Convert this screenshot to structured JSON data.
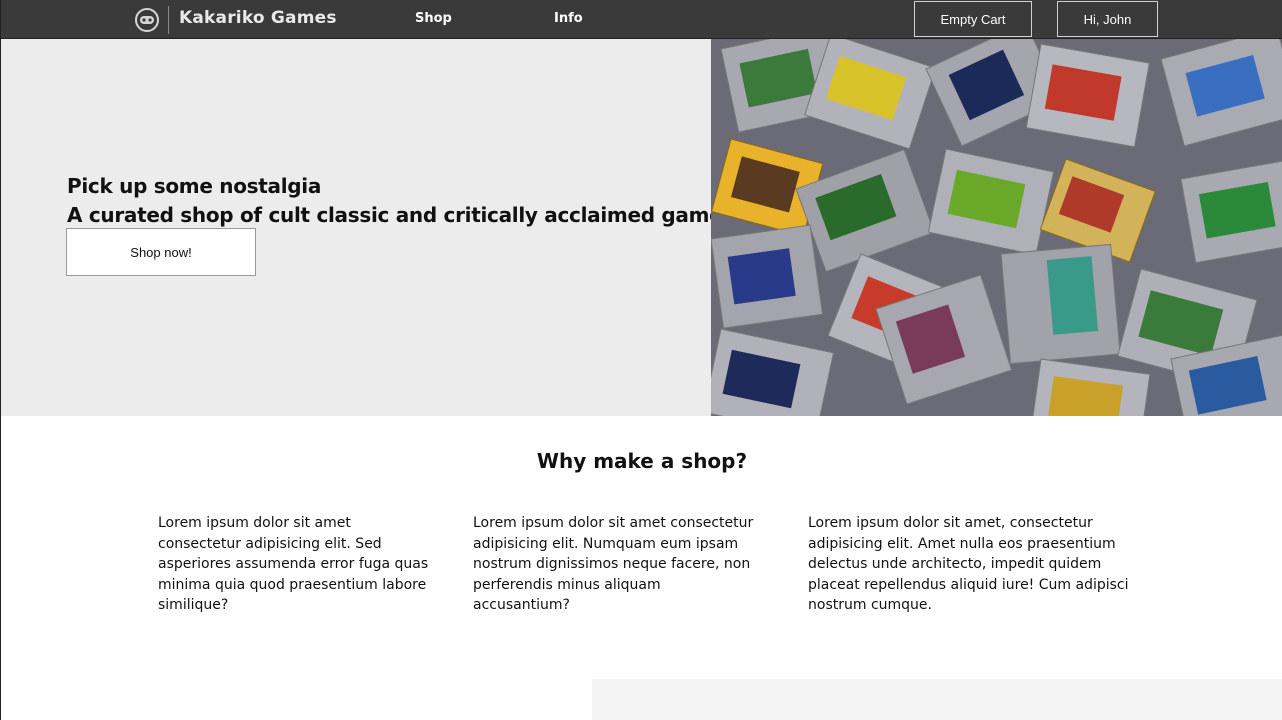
{
  "navbar": {
    "logo_icon": "gamepad-icon",
    "brand": "Kakariko Games",
    "links": [
      {
        "label": "Shop"
      },
      {
        "label": "Info"
      }
    ],
    "cart_button": "Empty Cart",
    "user_button": "Hi, John",
    "background": "#3a3a3a"
  },
  "hero": {
    "line1": "Pick up some nostalgia",
    "line2": "A curated shop of cult classic and critically acclaimed games",
    "cta_label": "Shop now!",
    "image_icon": "game-cartridges-photo",
    "background": "#ececec"
  },
  "why": {
    "title": "Why make a shop?",
    "columns": [
      {
        "text": "Lorem ipsum dolor sit amet consectetur adipisicing elit. Sed asperiores assumenda error fuga quas minima quia quod praesentium labore similique?"
      },
      {
        "text": "Lorem ipsum dolor sit amet consectetur adipisicing elit. Numquam eum ipsam nostrum dignissimos neque facere, non perferendis minus aliquam accusantium?"
      },
      {
        "text": "Lorem ipsum dolor sit amet, consectetur adipisicing elit. Amet nulla eos praesentium delectus unde architecto, impedit quidem placeat repellendus aliquid iure! Cum adipisci nostrum cumque."
      }
    ]
  }
}
